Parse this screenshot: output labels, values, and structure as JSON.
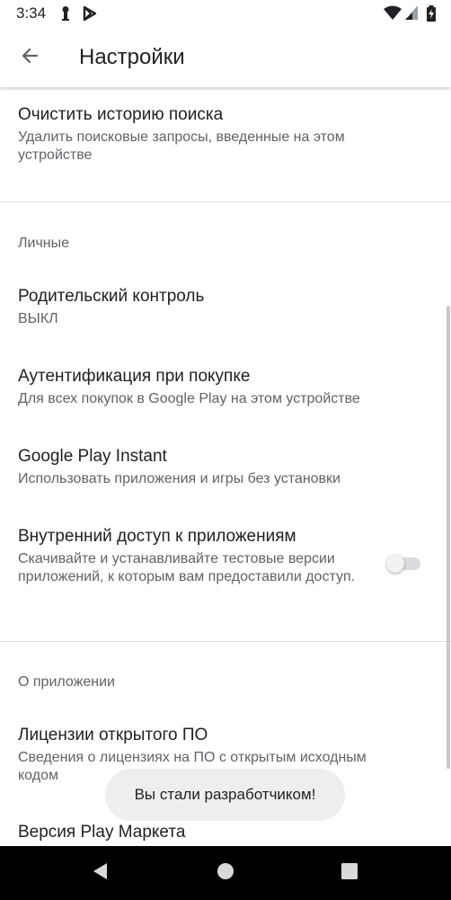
{
  "status_bar": {
    "time": "3:34"
  },
  "app_bar": {
    "title": "Настройки"
  },
  "items": {
    "clear_history": {
      "title": "Очистить историю поиска",
      "subtitle": "Удалить поисковые запросы, введенные на этом устройстве"
    },
    "personal_header": "Личные",
    "parental": {
      "title": "Родительский контроль",
      "subtitle": "ВЫКЛ"
    },
    "auth": {
      "title": "Аутентификация при покупке",
      "subtitle": "Для всех покупок в Google Play на этом устройстве"
    },
    "instant": {
      "title": "Google Play Instant",
      "subtitle": "Использовать приложения и игры без установки"
    },
    "internal": {
      "title": "Внутренний доступ к приложениям",
      "subtitle": "Скачивайте и устанавливайте тестовые версии приложений, к которым вам предоставили доступ.",
      "toggle_on": false
    },
    "about_header": "О приложении",
    "licenses": {
      "title": "Лицензии открытого ПО",
      "subtitle": "Сведения о лицензиях на ПО с открытым исходным кодом"
    },
    "version": {
      "title": "Версия Play Маркета"
    }
  },
  "toast": "Вы стали разработчиком!",
  "colors": {
    "text_primary": "#202124",
    "text_secondary": "#5f6368",
    "divider": "#dadce0",
    "toast_bg": "#eeeeee",
    "nav_bar": "#000000"
  },
  "icons": {
    "back": "arrow-left-icon",
    "nav_back": "triangle-back-icon",
    "nav_home": "circle-home-icon",
    "nav_recents": "square-recents-icon"
  }
}
